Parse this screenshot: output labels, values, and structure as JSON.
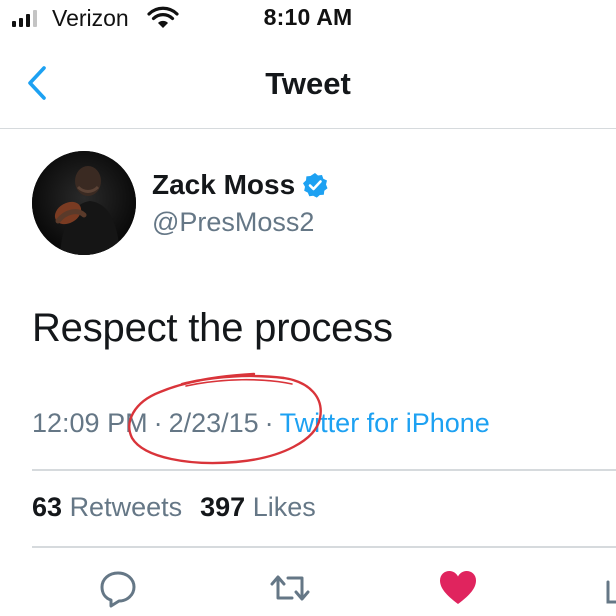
{
  "status_bar": {
    "carrier": "Verizon",
    "time": "8:10 AM"
  },
  "nav": {
    "title": "Tweet"
  },
  "author": {
    "display_name": "Zack Moss",
    "handle": "@PresMoss2",
    "verified": true
  },
  "tweet": {
    "text": "Respect the process",
    "time": "12:09 PM",
    "date": "2/23/15",
    "source": "Twitter for iPhone",
    "separator": "·"
  },
  "stats": {
    "retweets_count": "63",
    "retweets_label": "Retweets",
    "likes_count": "397",
    "likes_label": "Likes"
  },
  "icons": {
    "back": "chevron-left-icon",
    "verified": "verified-badge-icon",
    "reply": "reply-icon",
    "retweet": "retweet-icon",
    "like": "heart-icon",
    "share": "share-icon"
  },
  "colors": {
    "accent": "#1da1f2",
    "like": "#e0245e",
    "secondary_text": "#657786",
    "annotation": "#d9343a"
  }
}
